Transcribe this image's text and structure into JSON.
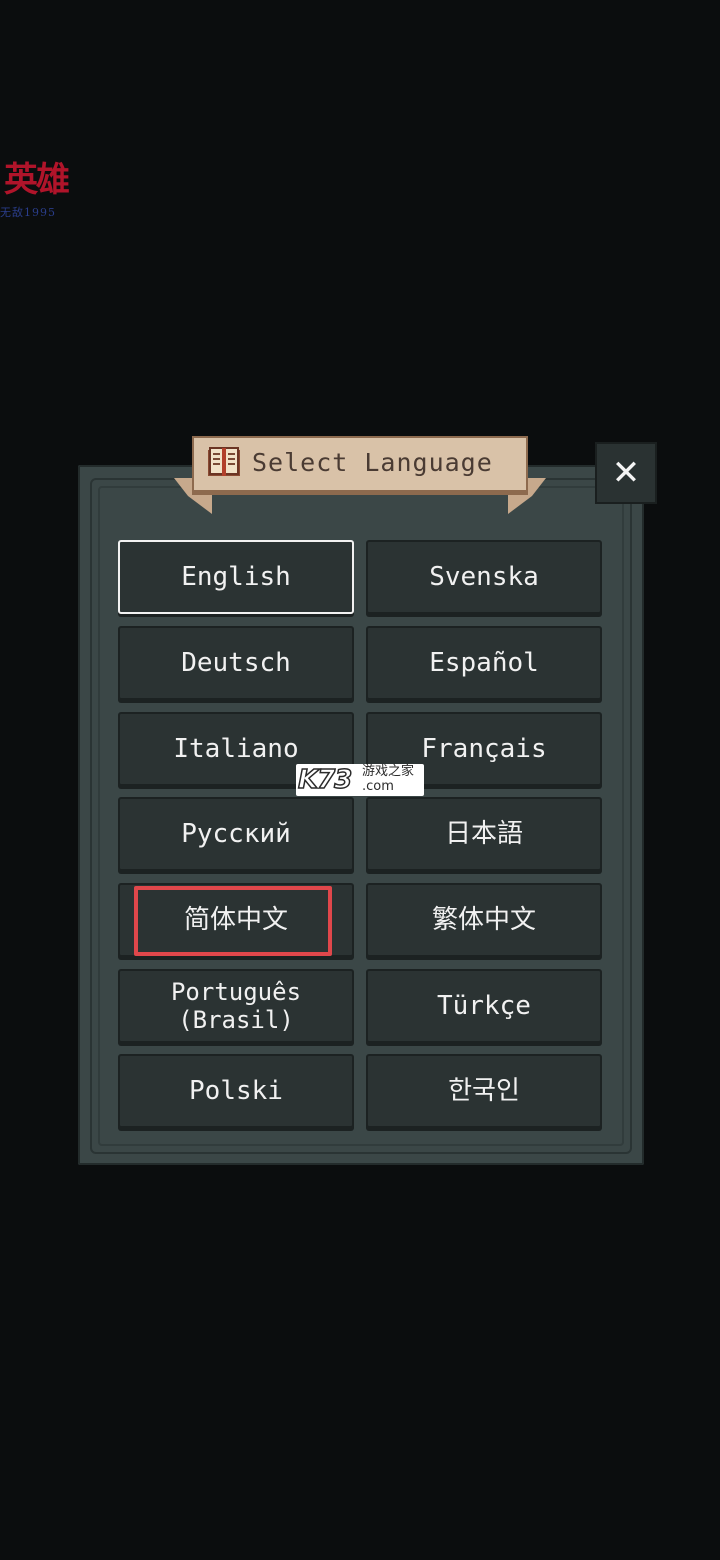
{
  "logo": {
    "main": "英雄",
    "sub": "无敌1995",
    "color": "#b0142a"
  },
  "dialog": {
    "title": "Select Language",
    "title_icon": "book-icon",
    "close_icon": "close-icon",
    "close_label": "✕"
  },
  "languages": [
    {
      "label": "English",
      "selected": true
    },
    {
      "label": "Svenska",
      "selected": false
    },
    {
      "label": "Deutsch",
      "selected": false
    },
    {
      "label": "Español",
      "selected": false
    },
    {
      "label": "Italiano",
      "selected": false
    },
    {
      "label": "Français",
      "selected": false
    },
    {
      "label": "Русский",
      "selected": false
    },
    {
      "label": "日本語",
      "selected": false
    },
    {
      "label": "简体中文",
      "selected": false
    },
    {
      "label": "繁体中文",
      "selected": false
    },
    {
      "label": "Português\n(Brasil)",
      "selected": false
    },
    {
      "label": "Türkçe",
      "selected": false
    },
    {
      "label": "Polski",
      "selected": false
    },
    {
      "label": "한국인",
      "selected": false
    }
  ],
  "highlight": {
    "target": "简体中文",
    "color": "#e0474b"
  },
  "watermark": {
    "logo": "K73",
    "text_cn": "游戏之家",
    "text_domain": ".com"
  }
}
